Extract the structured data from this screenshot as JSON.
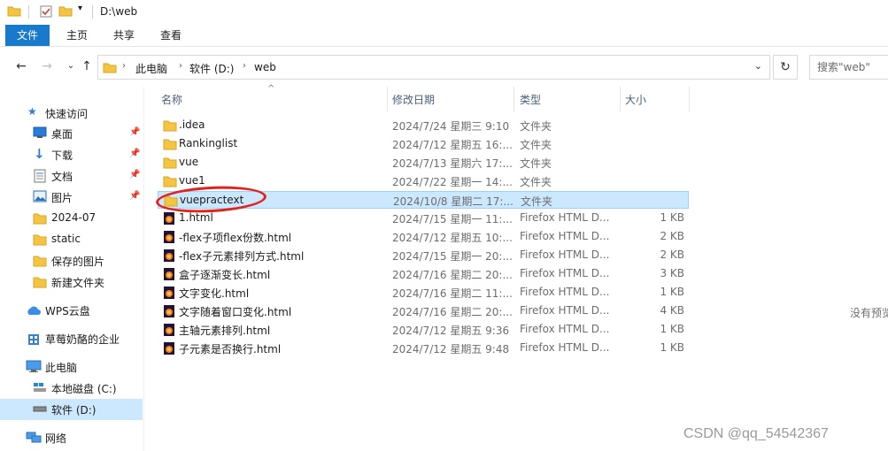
{
  "window": {
    "title": "D:\\web"
  },
  "ribbon": {
    "tabs": [
      "文件",
      "主页",
      "共享",
      "查看"
    ]
  },
  "address": {
    "crumbs": [
      "此电脑",
      "软件 (D:)",
      "web"
    ],
    "search_placeholder": "搜索\"web\""
  },
  "sidebar": {
    "quick_access": "快速访问",
    "items": [
      {
        "label": "桌面",
        "icon": "desktop-icon",
        "pinned": true
      },
      {
        "label": "下载",
        "icon": "download-icon",
        "pinned": true
      },
      {
        "label": "文档",
        "icon": "document-icon",
        "pinned": true
      },
      {
        "label": "图片",
        "icon": "picture-icon",
        "pinned": true
      },
      {
        "label": "2024-07",
        "icon": "folder-icon",
        "pinned": false
      },
      {
        "label": "static",
        "icon": "folder-icon",
        "pinned": false
      },
      {
        "label": "保存的图片",
        "icon": "folder-icon",
        "pinned": false
      },
      {
        "label": "新建文件夹",
        "icon": "folder-icon",
        "pinned": false
      }
    ],
    "wps": "WPS云盘",
    "enterprise": "草莓奶酪的企业",
    "this_pc": "此电脑",
    "drive_c": "本地磁盘 (C:)",
    "drive_d": "软件 (D:)",
    "network": "网络"
  },
  "columns": {
    "name": "名称",
    "date": "修改日期",
    "type": "类型",
    "size": "大小"
  },
  "files": [
    {
      "name": ".idea",
      "date": "2024/7/24 星期三 9:10",
      "type": "文件夹",
      "size": "",
      "kind": "folder"
    },
    {
      "name": "Rankinglist",
      "date": "2024/7/12 星期五 16:...",
      "type": "文件夹",
      "size": "",
      "kind": "folder"
    },
    {
      "name": "vue",
      "date": "2024/7/13 星期六 17:...",
      "type": "文件夹",
      "size": "",
      "kind": "folder"
    },
    {
      "name": "vue1",
      "date": "2024/7/22 星期一 14:...",
      "type": "文件夹",
      "size": "",
      "kind": "folder"
    },
    {
      "name": "vuepractext",
      "date": "2024/10/8 星期二 17:...",
      "type": "文件夹",
      "size": "",
      "kind": "folder",
      "selected": true
    },
    {
      "name": "1.html",
      "date": "2024/7/15 星期一 11:...",
      "type": "Firefox HTML D...",
      "size": "1 KB",
      "kind": "html"
    },
    {
      "name": "-flex子项flex份数.html",
      "date": "2024/7/12 星期五 10:...",
      "type": "Firefox HTML D...",
      "size": "2 KB",
      "kind": "html"
    },
    {
      "name": "-flex子元素排列方式.html",
      "date": "2024/7/15 星期一 20:...",
      "type": "Firefox HTML D...",
      "size": "2 KB",
      "kind": "html"
    },
    {
      "name": "盒子逐渐变长.html",
      "date": "2024/7/16 星期二 20:...",
      "type": "Firefox HTML D...",
      "size": "3 KB",
      "kind": "html"
    },
    {
      "name": "文字变化.html",
      "date": "2024/7/16 星期二 11:...",
      "type": "Firefox HTML D...",
      "size": "1 KB",
      "kind": "html"
    },
    {
      "name": "文字随着窗口变化.html",
      "date": "2024/7/16 星期二 20:...",
      "type": "Firefox HTML D...",
      "size": "4 KB",
      "kind": "html"
    },
    {
      "name": "主轴元素排列.html",
      "date": "2024/7/12 星期五 9:36",
      "type": "Firefox HTML D...",
      "size": "1 KB",
      "kind": "html"
    },
    {
      "name": "子元素是否换行.html",
      "date": "2024/7/12 星期五 9:48",
      "type": "Firefox HTML D...",
      "size": "1 KB",
      "kind": "html"
    }
  ],
  "preview": {
    "text": "没有预览"
  },
  "watermark": "CSDN @qq_54542367"
}
